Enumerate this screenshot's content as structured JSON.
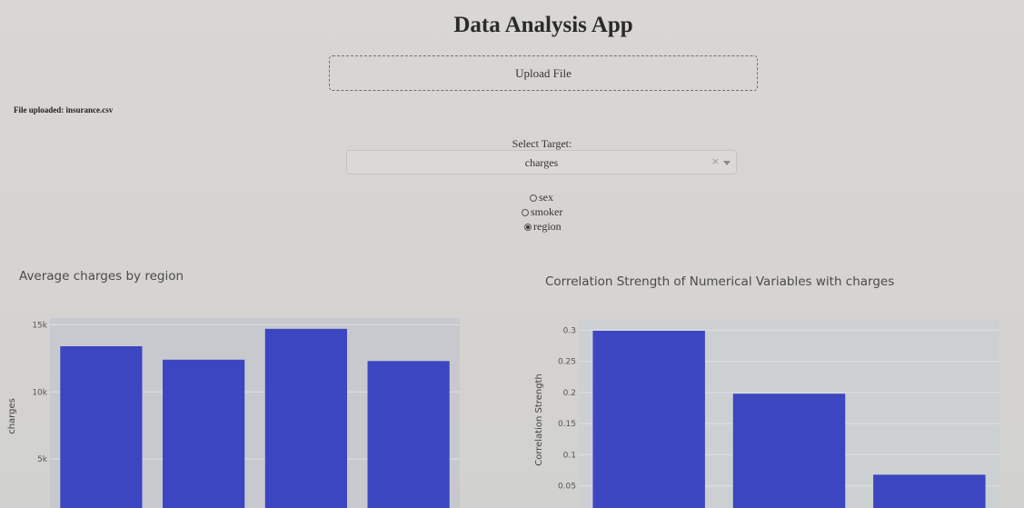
{
  "app": {
    "title": "Data Analysis App"
  },
  "upload": {
    "label": "Upload File",
    "status": "File uploaded: insurance.csv"
  },
  "target": {
    "label": "Select Target:",
    "value": "charges",
    "clear_symbol": "×"
  },
  "group_by": {
    "options": [
      {
        "label": "sex",
        "checked": false
      },
      {
        "label": "smoker",
        "checked": false
      },
      {
        "label": "region",
        "checked": true
      }
    ]
  },
  "chart_data": [
    {
      "type": "bar",
      "title": "Average charges by region",
      "ylabel": "charges",
      "xlabel": "",
      "categories": [
        "",
        "",
        "",
        ""
      ],
      "values": [
        13400,
        12400,
        14700,
        12300
      ],
      "ylim": [
        0,
        15500
      ],
      "yticks": [
        5000,
        10000,
        15000
      ],
      "ytick_labels": [
        "5k",
        "10k",
        "15k"
      ],
      "bar_color": "#3b46c0",
      "plot_bg": "#c8c9ce",
      "grid": true
    },
    {
      "type": "bar",
      "title": "Correlation Strength of Numerical Variables with charges",
      "ylabel": "Correlation Strength",
      "xlabel": "",
      "categories": [
        "",
        "",
        ""
      ],
      "values": [
        0.299,
        0.198,
        0.068
      ],
      "ylim": [
        0,
        0.315
      ],
      "yticks": [
        0.05,
        0.1,
        0.15,
        0.2,
        0.25,
        0.3
      ],
      "ytick_labels": [
        "0.05",
        "0.1",
        "0.15",
        "0.2",
        "0.25",
        "0.3"
      ],
      "bar_color": "#3b46c0",
      "plot_bg": "#cdd0d3",
      "grid": true
    }
  ]
}
